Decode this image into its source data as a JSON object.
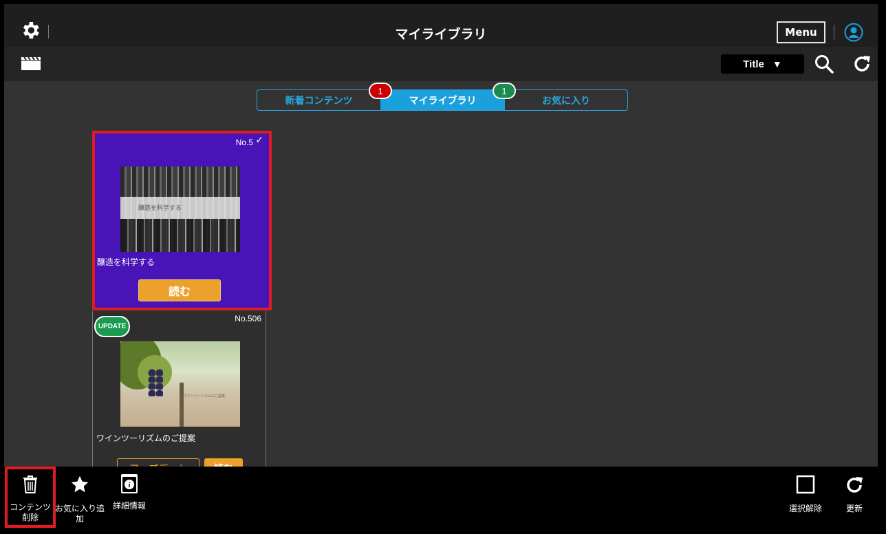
{
  "header": {
    "title": "マイライブラリ",
    "menu_label": "Menu",
    "icons": [
      "gear-icon",
      "user-icon"
    ]
  },
  "toolbar": {
    "sort_value": "Title",
    "sort_arrow": "▼",
    "icons": [
      "clapperboard-icon",
      "search-icon",
      "refresh-icon"
    ]
  },
  "tabs": [
    {
      "label": "新着コンテンツ",
      "badge": "1",
      "badge_color": "#cc0000"
    },
    {
      "label": "マイライブラリ",
      "badge": "1",
      "badge_color": "#1a8d4e",
      "active": true
    },
    {
      "label": "お気に入り"
    }
  ],
  "cards": [
    {
      "number": "No.5",
      "checkmark": "✓",
      "thumb_text": "醸造を科学する",
      "title": "醸造を科学する",
      "read_label": "読む",
      "selected": true,
      "background": "#4814b7"
    },
    {
      "number": "No.506",
      "badge": "UPDATE",
      "thumb_text": "ワインツーリズムのご提案",
      "title": "ワインツーリズムのご提案",
      "update_label": "アップデート",
      "read_label": "読む"
    }
  ],
  "bottom": {
    "delete_label": "コンテンツ削除",
    "favorite_label": "お気に入り追加",
    "info_label": "詳細情報",
    "deselect_label": "選択解除",
    "refresh_label": "更新"
  },
  "colors": {
    "accent": "#1ba0de",
    "selection_border": "#e21b23",
    "read_button": "#eba12b",
    "update_badge": "#1a9b50"
  }
}
